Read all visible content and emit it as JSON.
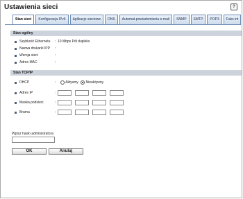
{
  "title": "Ustawienia sieci",
  "tabs": [
    {
      "label": "Stan sieci"
    },
    {
      "label": "Konfiguracja IPv6"
    },
    {
      "label": "Aplikacje sieciowe"
    },
    {
      "label": "DNS"
    },
    {
      "label": "Automat.powiadomienia e-mail"
    },
    {
      "label": "SNMP"
    },
    {
      "label": "SMTP"
    },
    {
      "label": "POP3"
    },
    {
      "label": "Faks int"
    }
  ],
  "stan_ogolny": {
    "header": "Stan ogólny",
    "rows": [
      {
        "label": "Szybkość Ethernetu",
        "value": "10 Mbps Pół dupleks"
      },
      {
        "label": "Nazwa drukarki IPP",
        "value": ""
      },
      {
        "label": "Wersja sieci",
        "value": ""
      },
      {
        "label": "Adres MAC",
        "value": ""
      }
    ]
  },
  "stan_tcpip": {
    "header": "Stan TCP/IP",
    "dhcp_label": "DHCP",
    "dhcp_on": "Aktywny",
    "dhcp_off": "Nieaktywny",
    "dhcp_selected": "Nieaktywny",
    "ip_label": "Adres IP",
    "mask_label": "Maska podsieci",
    "gateway_label": "Brama"
  },
  "password": {
    "label": "Wpisz hasło administratora",
    "value": ""
  },
  "buttons": {
    "ok": "OK",
    "cancel": "Anuluj"
  },
  "colors": {
    "section_header_bg": "#cdd3dc",
    "tab_border": "#6d8bb2",
    "bullet": "#4a5f7d"
  }
}
